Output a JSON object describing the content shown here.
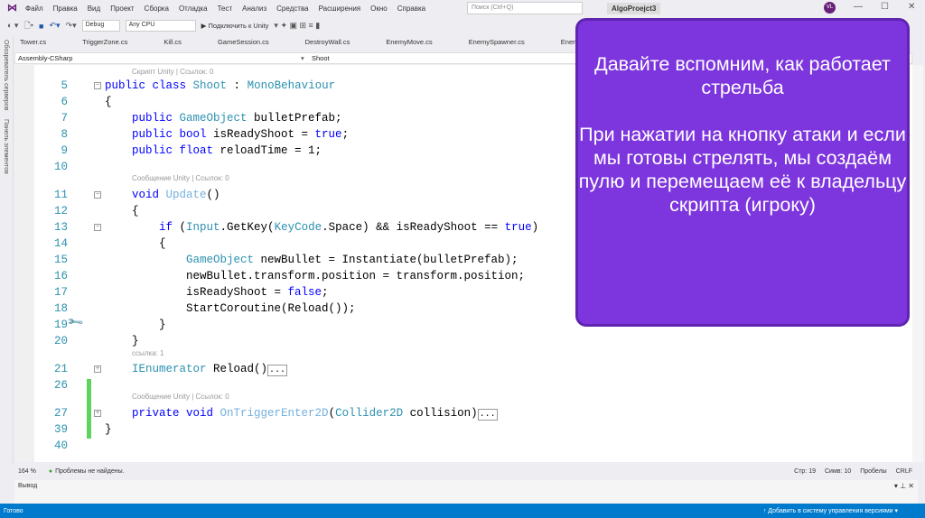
{
  "menu": [
    "Файл",
    "Правка",
    "Вид",
    "Проект",
    "Сборка",
    "Отладка",
    "Тест",
    "Анализ",
    "Средства",
    "Расширения",
    "Окно",
    "Справка"
  ],
  "search_placeholder": "Поиск (Ctrl+Q)",
  "project": "AlgoProejct3",
  "avatar": "VL",
  "toolbar": {
    "config": "Debug",
    "platform": "Any CPU",
    "attach": "▶ Подключить к Unity"
  },
  "sidebar": [
    "Обозреватель серверов",
    "Панель элементов"
  ],
  "tabs": [
    "Tower.cs",
    "TriggerZone.cs",
    "Kill.cs",
    "GameSession.cs",
    "DestroyWall.cs",
    "EnemyMove.cs",
    "EnemySpawner.cs",
    "EnemySt"
  ],
  "nav": {
    "project": "Assembly-CSharp",
    "class": "Shoot"
  },
  "code": [
    {
      "lens": "Скрипт Unity | Ссылок: 0",
      "num": "",
      "ind": 1
    },
    {
      "num": "5",
      "ind": 0,
      "fold": "−",
      "tok": [
        [
          "public class ",
          "kw"
        ],
        [
          "Shoot",
          "ty"
        ],
        [
          " : ",
          "tx"
        ],
        [
          "MonoBehaviour",
          "ty"
        ]
      ]
    },
    {
      "num": "6",
      "ind": 0,
      "tok": [
        [
          "{",
          "tx"
        ]
      ]
    },
    {
      "num": "7",
      "ind": 1,
      "tok": [
        [
          "public ",
          "kw"
        ],
        [
          "GameObject",
          "ty"
        ],
        [
          " bulletPrefab;",
          "tx"
        ]
      ]
    },
    {
      "num": "8",
      "ind": 1,
      "tok": [
        [
          "public bool ",
          "kw"
        ],
        [
          "isReadyShoot = ",
          "tx"
        ],
        [
          "true",
          "kw"
        ],
        [
          ";",
          "tx"
        ]
      ]
    },
    {
      "num": "9",
      "ind": 1,
      "tok": [
        [
          "public float ",
          "kw"
        ],
        [
          "reloadTime = 1;",
          "tx"
        ]
      ]
    },
    {
      "num": "10",
      "ind": 0,
      "tok": []
    },
    {
      "lens": "Сообщение Unity | Ссылок: 0",
      "num": "",
      "ind": 1
    },
    {
      "num": "11",
      "ind": 1,
      "fold": "−",
      "tok": [
        [
          "void ",
          "kw"
        ],
        [
          "Update",
          "mt"
        ],
        [
          "()",
          "tx"
        ]
      ]
    },
    {
      "num": "12",
      "ind": 1,
      "tok": [
        [
          "{",
          "tx"
        ]
      ]
    },
    {
      "num": "13",
      "ind": 2,
      "fold": "−",
      "tok": [
        [
          "if ",
          "kw"
        ],
        [
          "(",
          "tx"
        ],
        [
          "Input",
          "ty"
        ],
        [
          ".GetKey(",
          "tx"
        ],
        [
          "KeyCode",
          "ty"
        ],
        [
          ".Space) && isReadyShoot == ",
          "tx"
        ],
        [
          "true",
          "kw"
        ],
        [
          ")",
          "tx"
        ]
      ]
    },
    {
      "num": "14",
      "ind": 2,
      "tok": [
        [
          "{",
          "tx"
        ]
      ]
    },
    {
      "num": "15",
      "ind": 3,
      "tok": [
        [
          "GameObject",
          "ty"
        ],
        [
          " newBullet = Instantiate(bulletPrefab);",
          "tx"
        ]
      ]
    },
    {
      "num": "16",
      "ind": 3,
      "tok": [
        [
          "newBullet.transform.position = transform.position;",
          "tx"
        ]
      ]
    },
    {
      "num": "17",
      "ind": 3,
      "tok": [
        [
          "isReadyShoot = ",
          "tx"
        ],
        [
          "false",
          "kw"
        ],
        [
          ";",
          "tx"
        ]
      ]
    },
    {
      "num": "18",
      "ind": 3,
      "tok": [
        [
          "StartCoroutine(Reload());",
          "tx"
        ]
      ]
    },
    {
      "num": "19",
      "ind": 2,
      "tok": [
        [
          "}",
          "tx"
        ]
      ]
    },
    {
      "num": "20",
      "ind": 1,
      "tok": [
        [
          "}",
          "tx"
        ]
      ]
    },
    {
      "lens": "ссылка: 1",
      "num": "",
      "ind": 1
    },
    {
      "num": "21",
      "ind": 1,
      "fold": "+",
      "tok": [
        [
          "IEnumerator",
          "ty"
        ],
        [
          " Reload()",
          "tx"
        ]
      ],
      "col": "..."
    },
    {
      "num": "26",
      "ind": 0,
      "tok": []
    },
    {
      "lens": "Сообщение Unity | Ссылок: 0",
      "num": "",
      "ind": 1
    },
    {
      "num": "27",
      "ind": 1,
      "fold": "+",
      "tok": [
        [
          "private void ",
          "kw"
        ],
        [
          "OnTriggerEnter2D",
          "mt"
        ],
        [
          "(",
          "tx"
        ],
        [
          "Collider2D",
          "ty"
        ],
        [
          " collision)",
          "tx"
        ]
      ],
      "col": "..."
    },
    {
      "num": "39",
      "ind": 0,
      "tok": [
        [
          "}",
          "tx"
        ]
      ]
    },
    {
      "num": "40",
      "ind": 0,
      "tok": []
    }
  ],
  "status": {
    "zoom": "164 %",
    "problems": "Проблемы не найдены.",
    "line": "Стр: 19",
    "col": "Симв: 10",
    "spaces": "Пробелы",
    "eol": "CRLF"
  },
  "output": {
    "title": "Вывод"
  },
  "bottom": {
    "ready": "Готово",
    "vcs": "↑ Добавить в систему управления версиями ▾"
  },
  "overlay": {
    "p1": "Давайте вспомним, как работает стрельба",
    "p2": "При нажатии на кнопку атаки и если мы готовы стрелять, мы создаём пулю и перемещаем её к владельцу скрипта (игроку)"
  },
  "colors": {
    "accent": "#7d35dd",
    "statusbar": "#007acc"
  }
}
